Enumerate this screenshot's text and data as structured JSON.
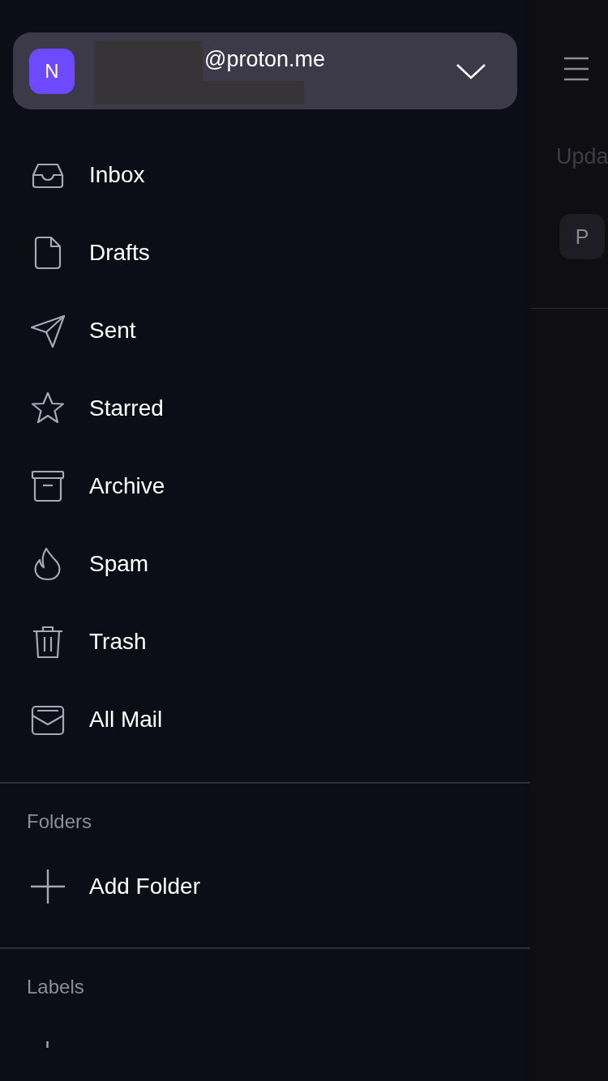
{
  "account": {
    "initial": "N",
    "email": "@proton.me"
  },
  "menu": [
    {
      "kind": "inbox",
      "label": "Inbox"
    },
    {
      "kind": "drafts",
      "label": "Drafts"
    },
    {
      "kind": "sent",
      "label": "Sent"
    },
    {
      "kind": "starred",
      "label": "Starred"
    },
    {
      "kind": "archive",
      "label": "Archive"
    },
    {
      "kind": "spam",
      "label": "Spam"
    },
    {
      "kind": "trash",
      "label": "Trash"
    },
    {
      "kind": "allmail",
      "label": "All Mail"
    }
  ],
  "folders": {
    "title": "Folders",
    "add_label": "Add Folder"
  },
  "labels": {
    "title": "Labels"
  },
  "background": {
    "heading": "Upda",
    "avatar": "P"
  }
}
